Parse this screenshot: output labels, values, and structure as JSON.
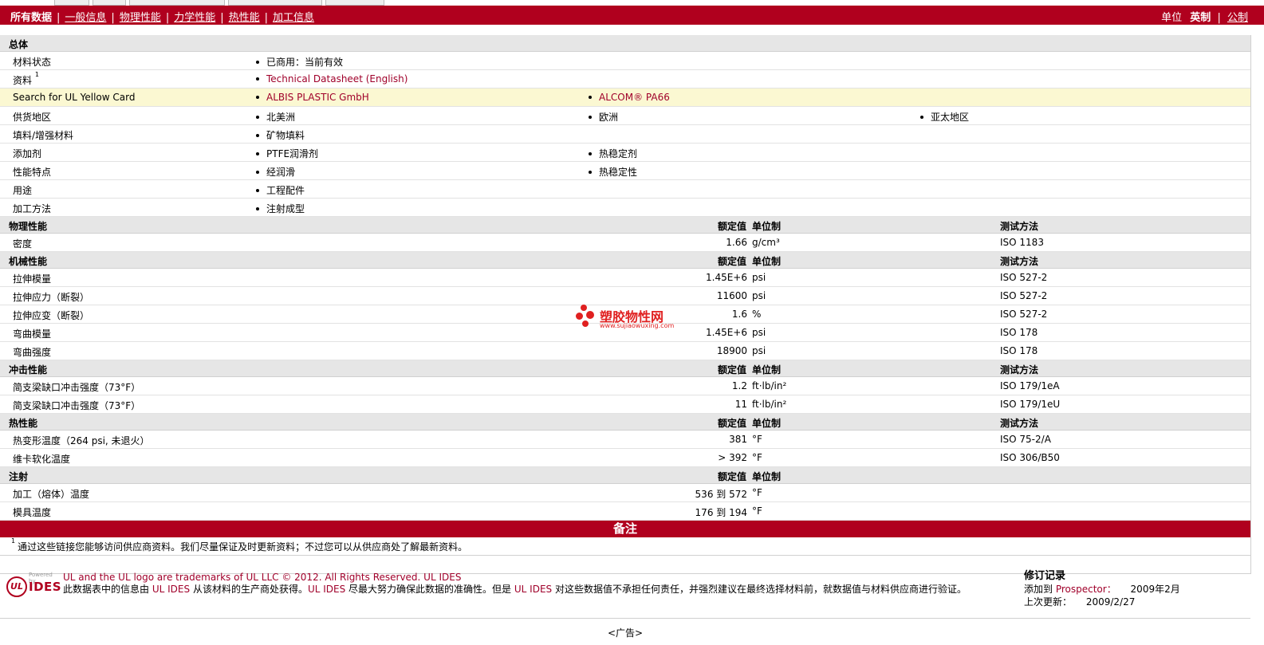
{
  "nav": {
    "items": [
      {
        "label": "所有数据",
        "active": true
      },
      {
        "label": "一般信息"
      },
      {
        "label": "物理性能"
      },
      {
        "label": "力学性能"
      },
      {
        "label": "热性能"
      },
      {
        "label": "加工信息"
      }
    ],
    "unit_label": "单位",
    "unit_selected": "英制",
    "unit_other": "公制",
    "separator": "|"
  },
  "general": {
    "title": "总体",
    "rows": [
      {
        "label": "材料状态",
        "values": [
          "已商用：当前有效"
        ]
      },
      {
        "label": "资料",
        "sup": "1",
        "values": [
          "Technical Datasheet (English)"
        ],
        "link": true
      },
      {
        "label": "Search for UL Yellow Card",
        "values": [
          "ALBIS PLASTIC GmbH",
          "ALCOM® PA66"
        ],
        "link": true,
        "highlight": true
      },
      {
        "label": "供货地区",
        "values": [
          "北美洲",
          "欧洲",
          "亚太地区"
        ]
      },
      {
        "label": "填料/增强材料",
        "values": [
          "矿物填料"
        ]
      },
      {
        "label": "添加剂",
        "values": [
          "PTFE润滑剂",
          "热稳定剂"
        ]
      },
      {
        "label": "性能特点",
        "values": [
          "经润滑",
          "热稳定性"
        ]
      },
      {
        "label": "用途",
        "values": [
          "工程配件"
        ]
      },
      {
        "label": "加工方法",
        "values": [
          "注射成型"
        ]
      }
    ]
  },
  "col_headers": {
    "nominal": "额定值",
    "unit": "单位制",
    "test": "测试方法"
  },
  "sections": [
    {
      "title": "物理性能",
      "show_test": true,
      "rows": [
        {
          "label": "密度",
          "value": "1.66",
          "unit": "g/cm³",
          "test": "ISO 1183"
        }
      ]
    },
    {
      "title": "机械性能",
      "show_test": true,
      "rows": [
        {
          "label": "拉伸模量",
          "value": "1.45E+6",
          "unit": "psi",
          "test": "ISO 527-2"
        },
        {
          "label": "拉伸应力（断裂）",
          "value": "11600",
          "unit": "psi",
          "test": "ISO 527-2"
        },
        {
          "label": "拉伸应变（断裂）",
          "value": "1.6",
          "unit": "%",
          "test": "ISO 527-2"
        },
        {
          "label": "弯曲模量",
          "value": "1.45E+6",
          "unit": "psi",
          "test": "ISO 178"
        },
        {
          "label": "弯曲强度",
          "value": "18900",
          "unit": "psi",
          "test": "ISO 178"
        }
      ]
    },
    {
      "title": "冲击性能",
      "show_test": true,
      "rows": [
        {
          "label": "简支梁缺口冲击强度（73°F）",
          "value": "1.2",
          "unit": "ft·lb/in²",
          "test": "ISO 179/1eA"
        },
        {
          "label": "简支梁缺口冲击强度（73°F）",
          "value": "11",
          "unit": "ft·lb/in²",
          "test": "ISO 179/1eU"
        }
      ]
    },
    {
      "title": "热性能",
      "show_test": true,
      "rows": [
        {
          "label": "热变形温度（264 psi, 未退火）",
          "value": "381",
          "unit": "°F",
          "test": "ISO 75-2/A"
        },
        {
          "label": "维卡软化温度",
          "value": "> 392",
          "unit": "°F",
          "test": "ISO 306/B50"
        }
      ]
    },
    {
      "title": "注射",
      "show_test": false,
      "rows": [
        {
          "label": "加工（熔体）温度",
          "value": "536 到   572",
          "unit": "°F",
          "test": ""
        },
        {
          "label": "模具温度",
          "value": "176 到   194",
          "unit": "°F",
          "test": ""
        }
      ]
    }
  ],
  "notes": {
    "title": "备注",
    "items": [
      {
        "sup": "1",
        "text": "通过这些链接您能够访问供应商资料。我们尽量保证及时更新资料；不过您可以从供应商处了解最新资料。"
      }
    ]
  },
  "footer": {
    "logo": {
      "powered": "Powered by",
      "ul": "UL",
      "ides": "IDES"
    },
    "trademark": "UL and the UL logo are trademarks of UL LLC © 2012. All Rights Reserved. UL IDES",
    "disclaimer_1": "此数据表中的信息由",
    "brand": "UL IDES",
    "disclaimer_2": "从该材料的生产商处获得。",
    "disclaimer_3": "尽最大努力确保此数据的准确性。但是",
    "disclaimer_4": "对这些数据值不承担任何责任，并强烈建议在最终选择材料前，就数据值与材料供应商进行验证。",
    "revision_title": "修订记录",
    "added_label": "添加到",
    "added_target": "Prospector：",
    "added_date": "2009年2月",
    "updated_label": "上次更新：",
    "updated_date": "2009/2/27"
  },
  "ad_label": "<广告>",
  "watermark": {
    "title": "塑胶物性网",
    "url": "www.sujiaowuxing.com"
  },
  "colors": {
    "brand_red": "#b0001e",
    "link": "#a0002a",
    "highlight": "#fbf8d2",
    "header_gray": "#e6e6e6"
  }
}
